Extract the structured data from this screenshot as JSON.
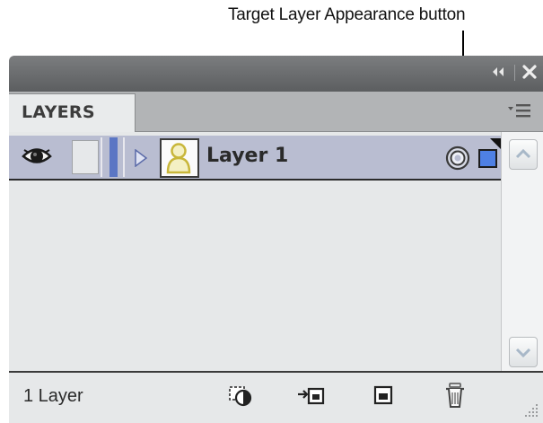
{
  "annotation": {
    "label": "Target Layer Appearance button"
  },
  "titlebar": {
    "collapse_icon": "double-chevron-left-icon",
    "close_icon": "close-icon"
  },
  "tabs": {
    "active_label": "LAYERS",
    "menu_icon": "panel-menu-icon"
  },
  "layers": [
    {
      "name": "Layer 1",
      "visible": true,
      "locked": false,
      "color": "#5b76c4",
      "expanded": false,
      "selected": true
    }
  ],
  "footer": {
    "count_label": "1 Layer",
    "buttons": [
      "make-clipping-mask-icon",
      "create-sublayer-icon",
      "create-new-layer-icon",
      "delete-layer-icon"
    ]
  },
  "colors": {
    "row_highlight": "#b9bdd1",
    "selection_color": "#4e80e4",
    "panel_bg": "#e6e8e9"
  }
}
